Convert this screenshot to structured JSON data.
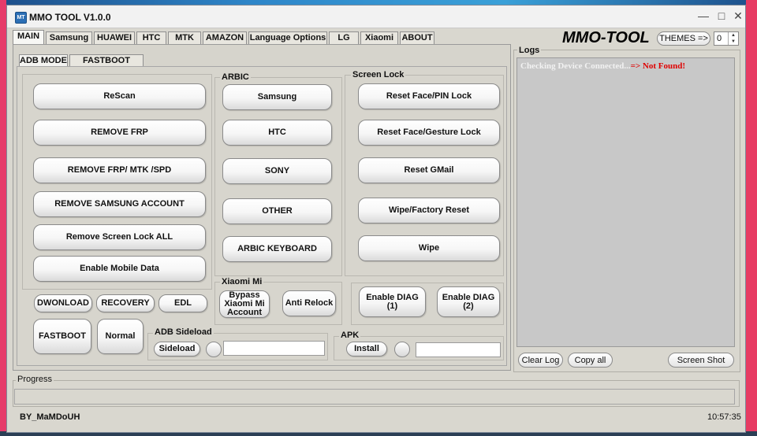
{
  "window": {
    "title": "MMO TOOL V1.0.0",
    "app_icon": "MT"
  },
  "tabs": [
    "MAIN",
    "Samsung",
    "HUAWEI",
    "HTC",
    "MTK",
    "AMAZON",
    "Language Options",
    "LG",
    "Xiaomi",
    "ABOUT"
  ],
  "brand": "MMO-TOOL",
  "themes_button": "THEMES =>",
  "theme_index": "0",
  "subtabs": [
    "ADB MODE",
    "FASTBOOT MODE"
  ],
  "left_buttons": [
    "ReScan",
    "REMOVE FRP",
    "REMOVE FRP/ MTK /SPD",
    "REMOVE SAMSUNG ACCOUNT",
    "Remove Screen Lock ALL",
    "Enable Mobile Data"
  ],
  "arbic": {
    "label": "ARBIC",
    "buttons": [
      "Samsung",
      "HTC",
      "SONY",
      "OTHER",
      "ARBIC KEYBOARD"
    ]
  },
  "screen_lock": {
    "label": "Screen Lock",
    "buttons": [
      "Reset Face/PIN Lock",
      "Reset Face/Gesture Lock",
      "Reset GMail",
      "Wipe/Factory Reset",
      "Wipe"
    ]
  },
  "mode_buttons": [
    "DWONLOAD",
    "RECOVERY",
    "EDL"
  ],
  "fastboot_button": "FASTBOOT",
  "normal_button": "Normal",
  "xiaomi": {
    "label": "Xiaomi Mi",
    "bypass": "Bypass Xiaomi Mi Account",
    "anti_relock": "Anti Relock"
  },
  "diag": [
    "Enable DIAG (1)",
    "Enable DIAG (2)"
  ],
  "adb_sideload": {
    "label": "ADB Sideload",
    "button": "Sideload",
    "value": ""
  },
  "apk": {
    "label": "APK",
    "button": "Install",
    "value": ""
  },
  "logs": {
    "label": "Logs",
    "line_a": "Checking Device Connected...",
    "line_b": "=> Not Found!",
    "color_a": "#f2f2f2",
    "color_b": "#e00000"
  },
  "log_buttons": {
    "clear": "Clear Log",
    "copy": "Copy all",
    "screenshot": "Screen Shot"
  },
  "progress": {
    "label": "Progress",
    "value": 0
  },
  "status": {
    "author": "BY_MaMDoUH",
    "time": "10:57:35"
  }
}
